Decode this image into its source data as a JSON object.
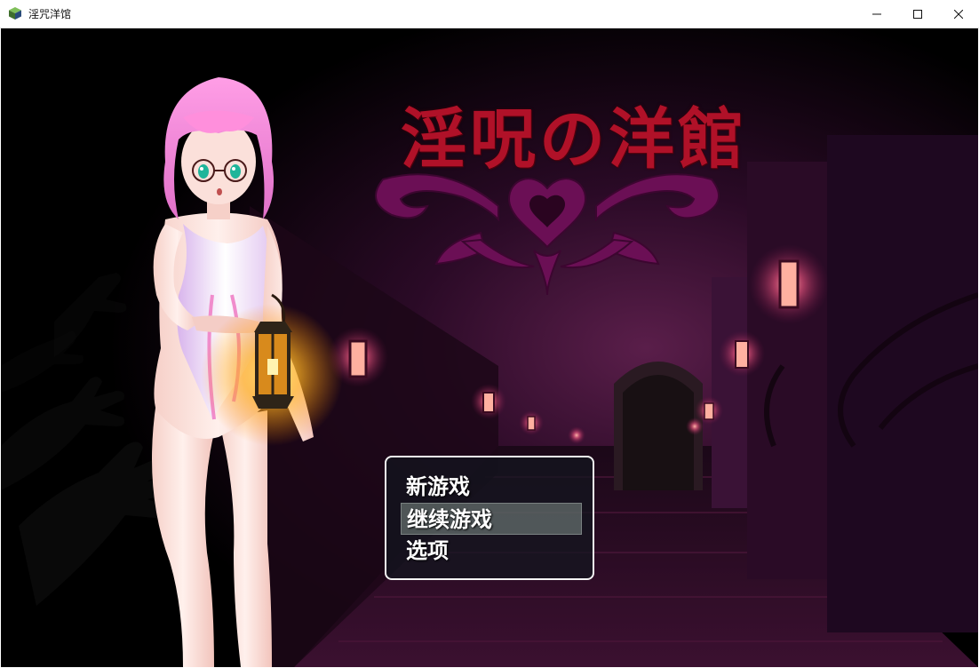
{
  "window": {
    "title": "淫咒洋馆",
    "controls": [
      "minimize",
      "maximize",
      "close"
    ]
  },
  "game": {
    "logo": "淫呪の洋館",
    "menu": {
      "items": [
        "新游戏",
        "继续游戏",
        "选项"
      ],
      "selected": "继续游戏"
    }
  },
  "colors": {
    "logo_red": "#b01128",
    "ornament_purple": "#6b0f55",
    "hair_pink": "#f38ad6",
    "lantern_glow": "#ffd24a",
    "menu_highlight": "#8ea89c"
  },
  "icons": {
    "app": "rpg-maker-cube-icon",
    "minimize": "minimize-icon",
    "maximize": "maximize-icon",
    "close": "close-icon"
  }
}
